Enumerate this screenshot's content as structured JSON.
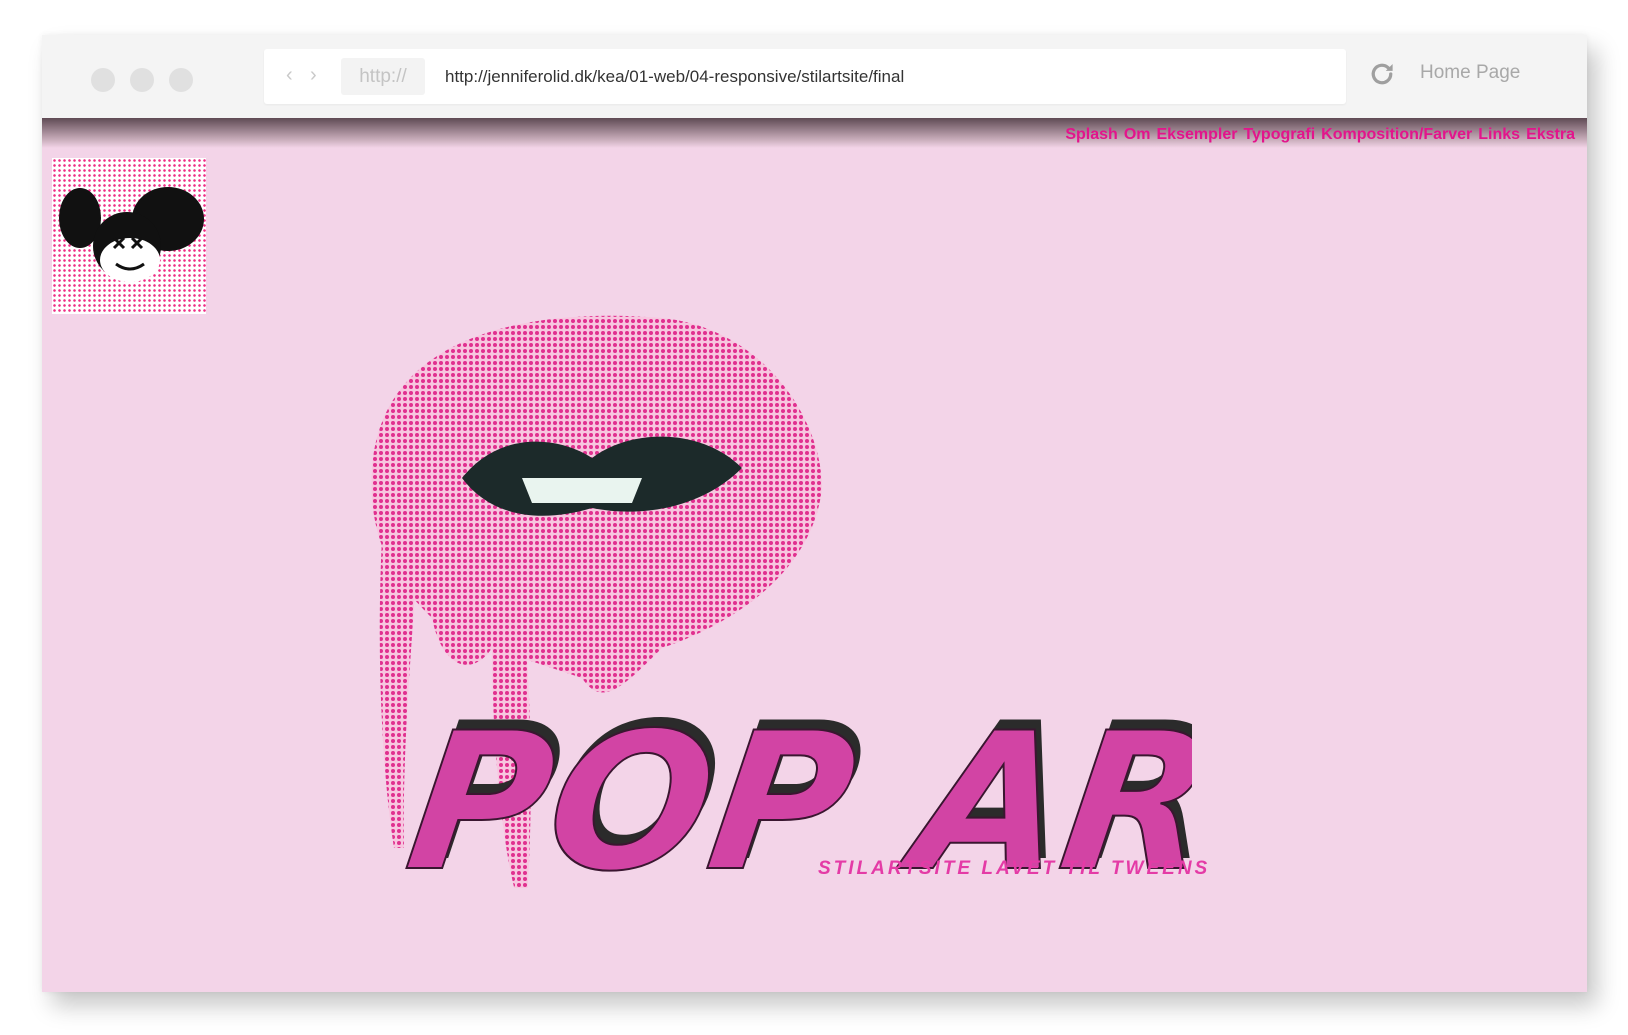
{
  "browser": {
    "protocol": "http://",
    "url": "http://jenniferolid.dk/kea/01-web/04-responsive/stilartsite/final",
    "home_label": "Home Page"
  },
  "nav": {
    "items": [
      "Splash",
      "Om",
      "Eksempler",
      "Typografi",
      "Komposition/Farver",
      "Links",
      "Ekstra"
    ]
  },
  "hero": {
    "title": "POP ART",
    "subtitle": "STILARTSITE LAVET TIL TWEENS"
  },
  "colors": {
    "page_bg": "#f3d4e8",
    "accent": "#e3148c",
    "title_pink": "#d244a4"
  },
  "icons": [
    "mouse-logo-icon",
    "lips-icon",
    "back-arrow-icon",
    "forward-arrow-icon",
    "reload-icon"
  ]
}
